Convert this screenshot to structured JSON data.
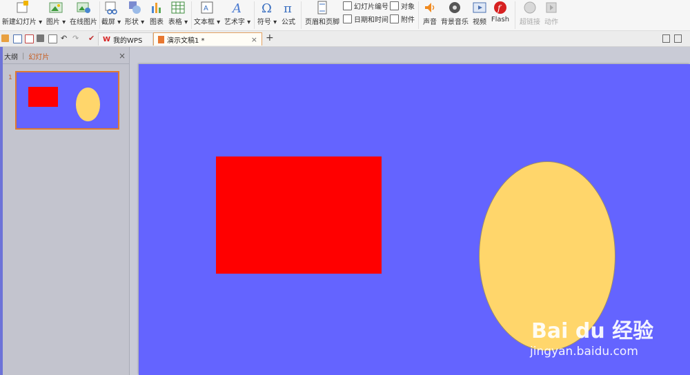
{
  "ribbon": {
    "items": [
      {
        "id": "new-slide",
        "label": "新建幻灯片 ▾",
        "icon": "new-slide-icon"
      },
      {
        "id": "picture",
        "label": "图片 ▾",
        "icon": "picture-icon"
      },
      {
        "id": "online-picture",
        "label": "在线图片",
        "icon": "online-picture-icon"
      },
      {
        "id": "screenshot",
        "label": "截屏 ▾",
        "icon": "scissors-icon"
      },
      {
        "id": "shapes",
        "label": "形状 ▾",
        "icon": "shapes-icon"
      },
      {
        "id": "chart",
        "label": "图表",
        "icon": "chart-icon"
      },
      {
        "id": "table",
        "label": "表格 ▾",
        "icon": "table-icon"
      },
      {
        "id": "textbox",
        "label": "文本框 ▾",
        "icon": "textbox-icon"
      },
      {
        "id": "wordart",
        "label": "艺术字 ▾",
        "icon": "wordart-icon"
      },
      {
        "id": "symbol",
        "label": "符号 ▾",
        "icon": "omega-icon"
      },
      {
        "id": "formula",
        "label": "公式",
        "icon": "pi-icon"
      },
      {
        "id": "header-footer",
        "label": "页眉和页脚",
        "icon": "header-footer-icon"
      },
      {
        "id": "audio",
        "label": "声音",
        "icon": "speaker-icon"
      },
      {
        "id": "bg-music",
        "label": "背景音乐",
        "icon": "music-icon"
      },
      {
        "id": "video",
        "label": "视频",
        "icon": "video-icon"
      },
      {
        "id": "flash",
        "label": "Flash",
        "icon": "flash-icon"
      },
      {
        "id": "hyperlink",
        "label": "超链接",
        "icon": "hyperlink-icon"
      },
      {
        "id": "action",
        "label": "动作",
        "icon": "action-icon"
      }
    ],
    "small": {
      "slide_number": "幻灯片编号",
      "object": "对象",
      "datetime": "日期和时间",
      "attachment": "附件"
    }
  },
  "tabs": {
    "mywps": "我的WPS",
    "doc": "演示文稿1 *",
    "close": "×",
    "add": "+"
  },
  "panel": {
    "outline": "大纲",
    "divider": "|",
    "slides": "幻灯片",
    "close": "×",
    "slide_number": "1"
  },
  "watermark": {
    "logo": "Bai du 经验",
    "url": "jingyan.baidu.com"
  },
  "colors": {
    "slide_bg": "#6464ff",
    "rect": "#ff0000",
    "oval": "#ffd66b",
    "accent": "#e07a30"
  }
}
